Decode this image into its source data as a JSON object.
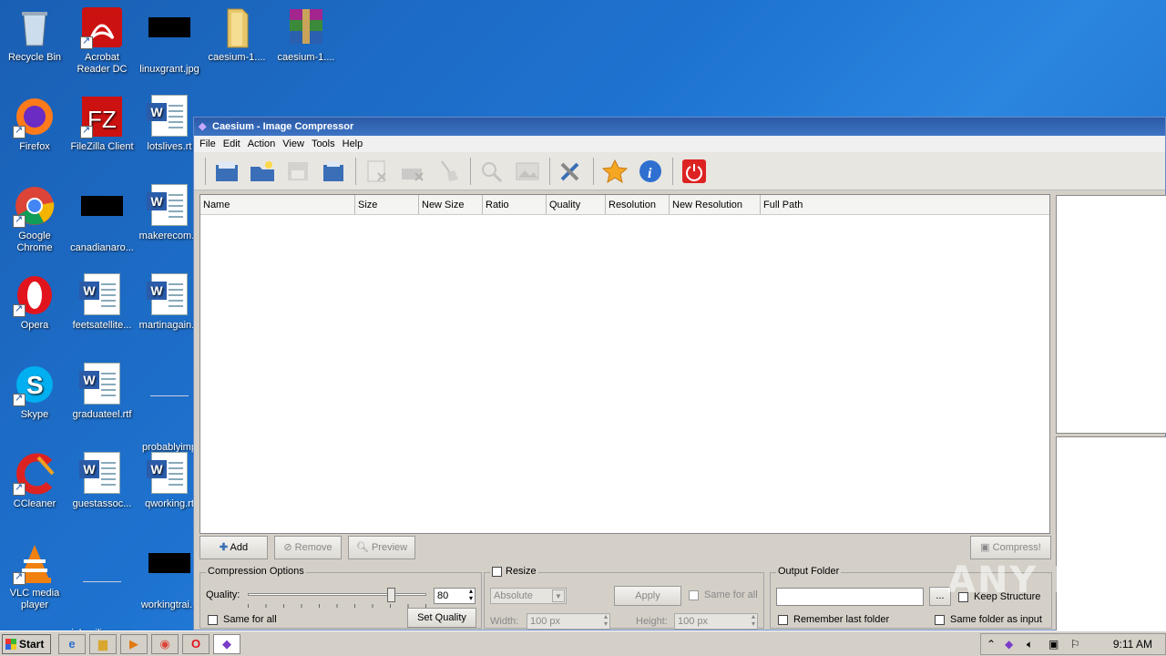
{
  "desktop": {
    "icons": [
      {
        "label": "Recycle Bin"
      },
      {
        "label": "Acrobat Reader DC"
      },
      {
        "label": "linuxgrant.jpg"
      },
      {
        "label": "caesium-1...."
      },
      {
        "label": "caesium-1...."
      },
      {
        "label": "Firefox"
      },
      {
        "label": "FileZilla Client"
      },
      {
        "label": "lotslives.rt"
      },
      {
        "label": "Google Chrome"
      },
      {
        "label": "canadianaro..."
      },
      {
        "label": "makerecom..."
      },
      {
        "label": "Opera"
      },
      {
        "label": "feetsatellite..."
      },
      {
        "label": "martinagain..."
      },
      {
        "label": "Skype"
      },
      {
        "label": "graduateel.rtf"
      },
      {
        "label": "probablyimp"
      },
      {
        "label": "CCleaner"
      },
      {
        "label": "guestassoc..."
      },
      {
        "label": "qworking.rt"
      },
      {
        "label": "VLC media player"
      },
      {
        "label": "julmailing.png"
      },
      {
        "label": "workingtrai..."
      }
    ]
  },
  "window": {
    "title": "Caesium - Image Compressor",
    "menu": [
      "File",
      "Edit",
      "Action",
      "View",
      "Tools",
      "Help"
    ],
    "columns": [
      "Name",
      "Size",
      "New Size",
      "Ratio",
      "Quality",
      "Resolution",
      "New Resolution",
      "Full Path"
    ],
    "buttons": {
      "add": "Add",
      "remove": "Remove",
      "preview": "Preview",
      "compress": "Compress!"
    },
    "compression": {
      "title": "Compression Options",
      "quality_label": "Quality:",
      "quality_value": "80",
      "quality_fraction": 0.8,
      "same_for_all": "Same for all",
      "set_quality": "Set Quality"
    },
    "resize": {
      "title": "Resize",
      "mode": "Absolute",
      "apply": "Apply",
      "same_for_all": "Same for all",
      "width_label": "Width:",
      "width_value": "100 px",
      "height_label": "Height:",
      "height_value": "100 px"
    },
    "output": {
      "title": "Output Folder",
      "browse": "...",
      "keep_structure": "Keep Structure",
      "remember_last": "Remember last folder",
      "same_folder": "Same folder as input"
    }
  },
  "taskbar": {
    "start": "Start",
    "clock": "9:11 AM"
  },
  "watermark": "ANY RUN"
}
